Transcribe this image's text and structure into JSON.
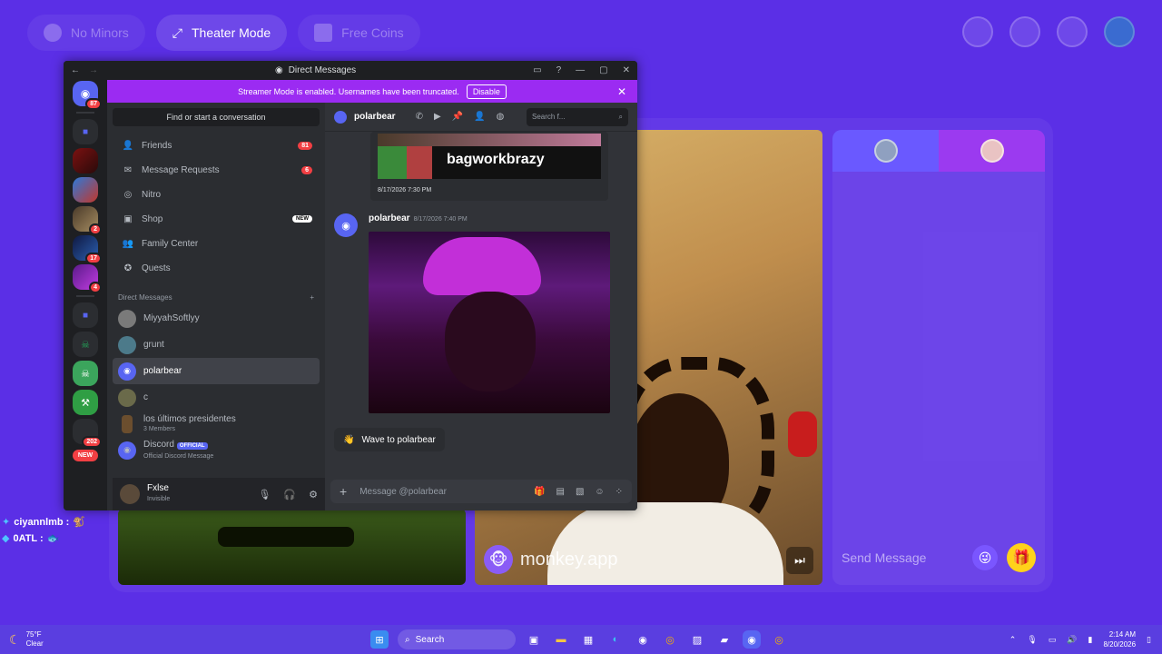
{
  "monkey": {
    "top_pills": [
      {
        "label": "No Minors",
        "icon": "no-minors-icon"
      },
      {
        "label": "Theater Mode",
        "icon": "theater-mode-icon"
      },
      {
        "label": "Free Coins",
        "icon": "coins-icon"
      }
    ],
    "brand": "monkey.app",
    "send_placeholder": "Send Message",
    "chat_lines": [
      {
        "user": "ciyannlmb :"
      },
      {
        "user": "0ATL :"
      }
    ]
  },
  "discord": {
    "window_title": "Direct Messages",
    "banner": {
      "text": "Streamer Mode is enabled. Usernames have been truncated.",
      "button": "Disable"
    },
    "home_badge": "87",
    "servers": [
      {
        "badge": ""
      },
      {
        "badge": ""
      },
      {
        "badge": "2"
      },
      {
        "badge": "17"
      },
      {
        "badge": "4"
      },
      {
        "badge": "202"
      }
    ],
    "new_label": "NEW",
    "find_placeholder": "Find or start a conversation",
    "nav": [
      {
        "label": "Friends",
        "icon": "friends-icon",
        "badge": "81"
      },
      {
        "label": "Message Requests",
        "icon": "mail-icon",
        "badge": "6"
      },
      {
        "label": "Nitro",
        "icon": "nitro-icon",
        "badge": ""
      },
      {
        "label": "Shop",
        "icon": "shop-icon",
        "tag": "NEW"
      },
      {
        "label": "Family Center",
        "icon": "family-icon",
        "badge": ""
      },
      {
        "label": "Quests",
        "icon": "quests-icon",
        "badge": ""
      }
    ],
    "dm_header": "Direct Messages",
    "dms": [
      {
        "name": "MiyyahSoftlyy",
        "sub": ""
      },
      {
        "name": "grunt",
        "sub": ""
      },
      {
        "name": "polarbear",
        "sub": ""
      },
      {
        "name": "c",
        "sub": ""
      },
      {
        "name": "los últimos presidentes",
        "sub": "3 Members"
      },
      {
        "name": "Discord",
        "sub": "Official Discord Message",
        "tag": "OFFICIAL"
      }
    ],
    "user": {
      "name": "Fxlse",
      "status": "Invisible"
    },
    "conversation": {
      "recipient": "polarbear",
      "search_placeholder": "Search f...",
      "embed_text": "bagworkbrazy",
      "embed_time": "8/17/2026 7:30 PM",
      "message_author": "polarbear",
      "message_time": "8/17/2026 7:40 PM",
      "wave_label": "Wave to polarbear",
      "composer_placeholder": "Message @polarbear"
    }
  },
  "taskbar": {
    "temp": "75°F",
    "condition": "Clear",
    "search": "Search",
    "time": "2:14 AM",
    "date": "8/20/2026"
  }
}
